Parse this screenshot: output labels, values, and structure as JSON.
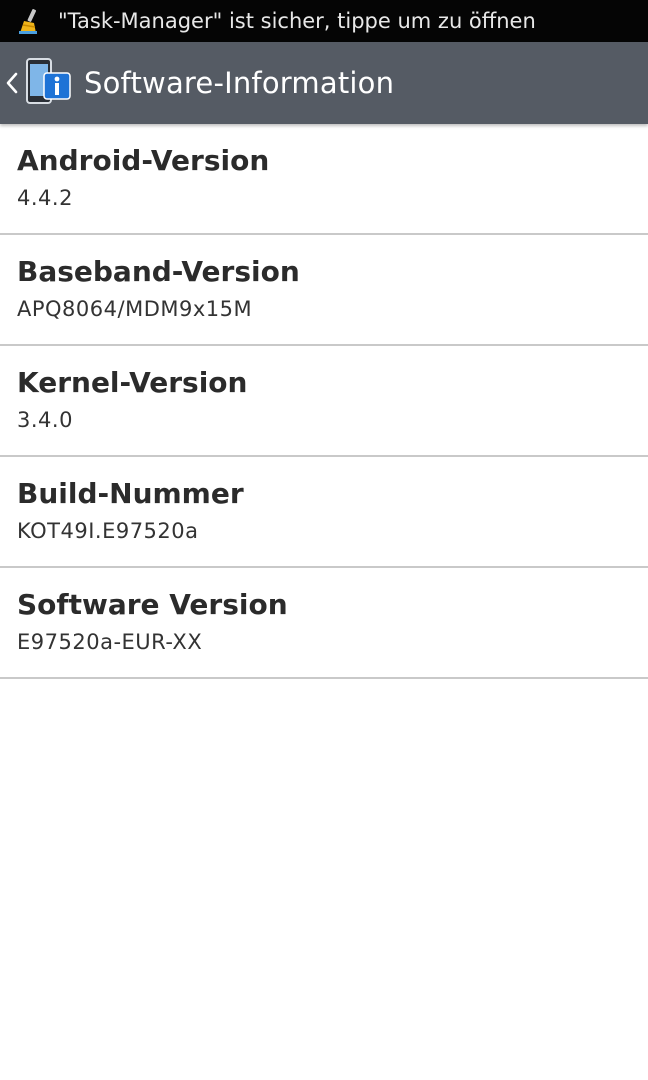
{
  "status_bar": {
    "notification_icon": "broom-icon",
    "notification_text": "\"Task-Manager\" ist sicher, tippe um zu öffnen"
  },
  "action_bar": {
    "back_icon": "chevron-left-icon",
    "app_icon": "software-info-icon",
    "title": "Software-Information",
    "background_color": "#555b64"
  },
  "items": [
    {
      "title": "Android-Version",
      "value": "4.4.2"
    },
    {
      "title": "Baseband-Version",
      "value": "APQ8064/MDM9x15M"
    },
    {
      "title": "Kernel-Version",
      "value": "3.4.0"
    },
    {
      "title": "Build-Nummer",
      "value": "KOT49I.E97520a"
    },
    {
      "title": "Software Version",
      "value": "E97520a-EUR-XX"
    }
  ]
}
